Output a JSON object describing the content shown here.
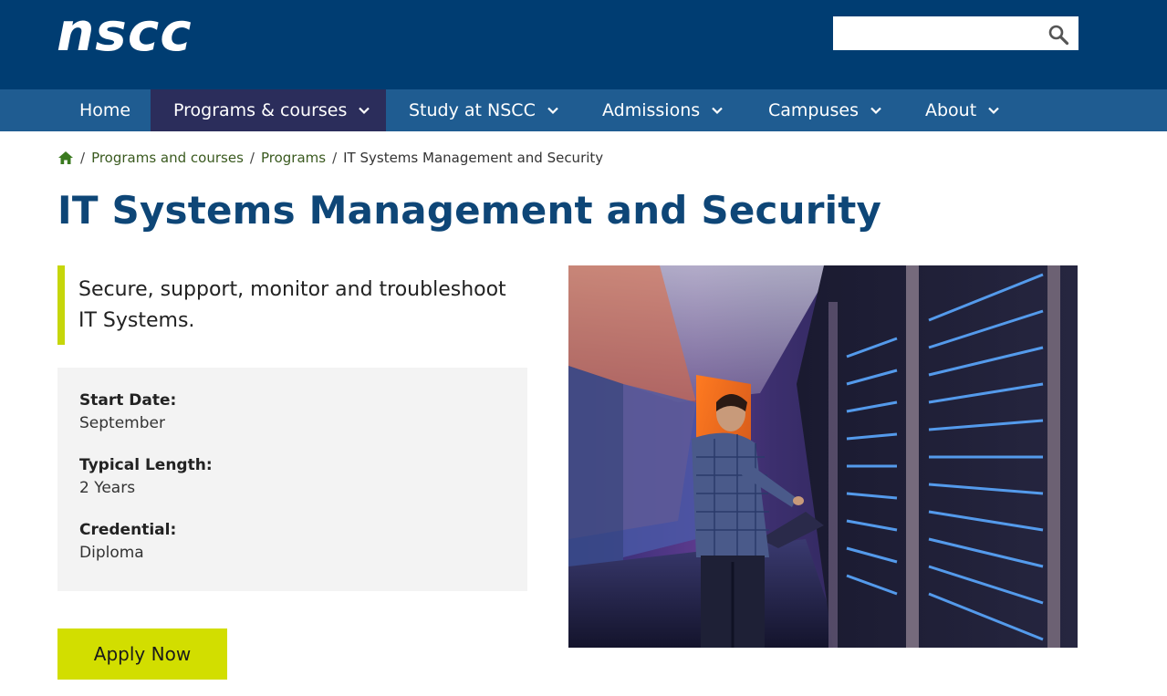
{
  "header": {
    "logo_text": "nscc",
    "search": {
      "placeholder": "",
      "value": "",
      "icon": "search-icon"
    }
  },
  "nav": {
    "items": [
      {
        "label": "Home",
        "has_dropdown": false,
        "active": false
      },
      {
        "label": "Programs & courses",
        "has_dropdown": true,
        "active": true
      },
      {
        "label": "Study at NSCC",
        "has_dropdown": true,
        "active": false
      },
      {
        "label": "Admissions",
        "has_dropdown": true,
        "active": false
      },
      {
        "label": "Campuses",
        "has_dropdown": true,
        "active": false
      },
      {
        "label": "About",
        "has_dropdown": true,
        "active": false
      }
    ]
  },
  "breadcrumb": {
    "home_icon": "home-icon",
    "items": [
      "Programs and courses",
      "Programs"
    ],
    "current": "IT Systems Management and Security"
  },
  "page": {
    "title": "IT Systems Management and Security",
    "tagline": "Secure, support, monitor and troubleshoot IT Systems."
  },
  "info": {
    "start_label": "Start Date:",
    "start_value": "September",
    "length_label": "Typical Length:",
    "length_value": "2 Years",
    "credential_label": "Credential:",
    "credential_value": "Diploma"
  },
  "cta": {
    "apply_label": "Apply Now"
  },
  "colors": {
    "header_bg": "#003d72",
    "nav_bg": "#1f5c91",
    "nav_active_bg": "#2b2d5b",
    "accent_lime": "#d2de00",
    "title_blue": "#0e4677",
    "breadcrumb_green": "#3a5a1f"
  }
}
